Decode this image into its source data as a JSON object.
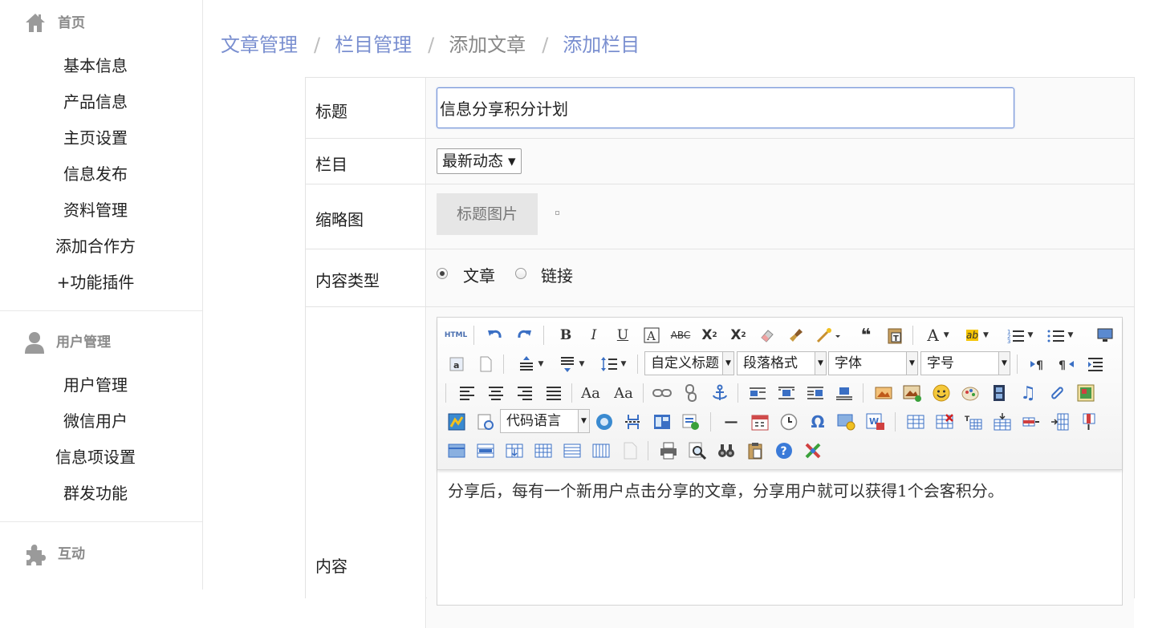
{
  "sidebar": {
    "home": {
      "title": "首页",
      "items": [
        "基本信息",
        "产品信息",
        "主页设置",
        "信息发布",
        "资料管理",
        "添加合作方",
        "+功能插件"
      ]
    },
    "users": {
      "title": "用户管理",
      "items": [
        "用户管理",
        "微信用户",
        "信息项设置",
        "群发功能"
      ]
    },
    "interact": {
      "title": "互动"
    }
  },
  "breadcrumb": {
    "items": [
      "文章管理",
      "栏目管理",
      "添加文章",
      "添加栏目"
    ],
    "separator": "/"
  },
  "form": {
    "title_label": "标题",
    "title_value": "信息分享积分计划",
    "column_label": "栏目",
    "column_value": "最新动态 ▾",
    "thumb_label": "缩略图",
    "thumb_button": "标题图片",
    "type_label": "内容类型",
    "type_option1": "文章",
    "type_option2": "链接",
    "content_label": "内容",
    "content_text": "分享后，每有一个新用户点击分享的文章，分享用户就可以获得1个会客积分。"
  },
  "editor": {
    "combo_custom_title": "自定义标题",
    "combo_paragraph": "段落格式",
    "combo_font": "字体",
    "combo_size": "字号",
    "combo_code": "代码语言",
    "html_label": "HTML"
  },
  "colors": {
    "link": "#7a8fd0",
    "accent_border": "#6f8fd6"
  }
}
